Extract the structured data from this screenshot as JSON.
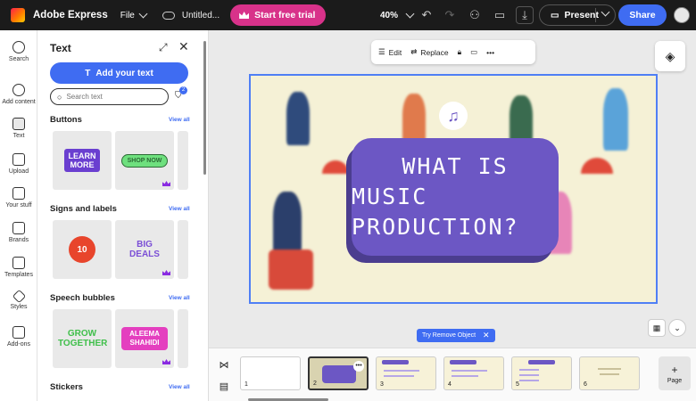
{
  "topbar": {
    "app_title": "Adobe Express",
    "file_label": "File",
    "doc_name": "Untitled...",
    "trial_label": "Start free trial",
    "zoom": "40%",
    "present_label": "Present",
    "share_label": "Share"
  },
  "rail": {
    "items": [
      {
        "label": "Search",
        "icon": "search-icon"
      },
      {
        "label": "Add content",
        "icon": "add-icon"
      },
      {
        "label": "Text",
        "icon": "text-icon"
      },
      {
        "label": "Upload",
        "icon": "upload-icon"
      },
      {
        "label": "Your stuff",
        "icon": "folder-icon"
      },
      {
        "label": "Brands",
        "icon": "brand-icon"
      },
      {
        "label": "Templates",
        "icon": "templates-icon"
      },
      {
        "label": "Styles",
        "icon": "styles-icon"
      },
      {
        "label": "Add-ons",
        "icon": "addons-icon"
      }
    ]
  },
  "panel": {
    "title": "Text",
    "add_text_label": "Add your text",
    "search_placeholder": "Search text",
    "filter_count": "2",
    "view_all": "View all",
    "sections": [
      {
        "title": "Buttons",
        "tiles": [
          "LEARN MORE",
          "SHOP NOW"
        ]
      },
      {
        "title": "Signs and labels",
        "tiles": [
          "10",
          "BIG DEALS"
        ]
      },
      {
        "title": "Speech bubbles",
        "tiles": [
          "GROW TOGETHER",
          "ALEEMA SHAHIDI"
        ]
      },
      {
        "title": "Stickers",
        "tiles": []
      }
    ]
  },
  "context_toolbar": {
    "edit_label": "Edit",
    "replace_label": "Replace"
  },
  "slide": {
    "line1": "WHAT IS",
    "line2": "MUSIC PRODUCTION?",
    "colors": {
      "card": "#6c57c4",
      "background": "#f5f1d6"
    }
  },
  "remove_object_label": "Try Remove Object",
  "pages": {
    "numbers": [
      "1",
      "2",
      "3",
      "4",
      "5",
      "6"
    ],
    "page_button_label": "Page"
  }
}
